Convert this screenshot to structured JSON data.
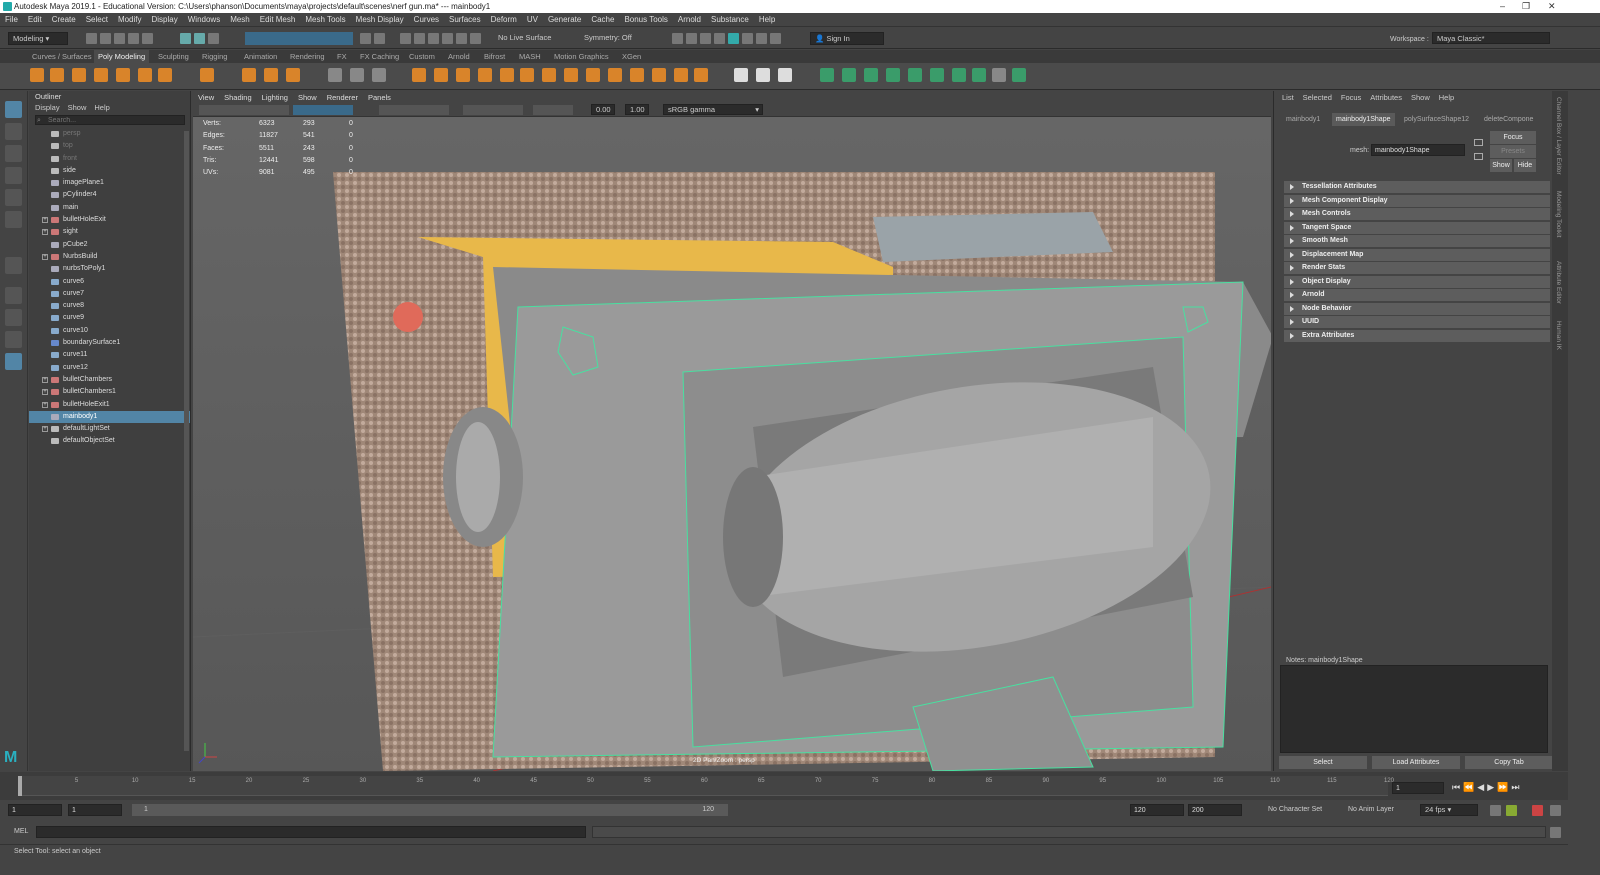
{
  "titlebar": {
    "title": "Autodesk Maya 2019.1 - Educational Version: C:\\Users\\phanson\\Documents\\maya\\projects\\default\\scenes\\nerf gun.ma*  ---  mainbody1"
  },
  "menubar": [
    "File",
    "Edit",
    "Create",
    "Select",
    "Modify",
    "Display",
    "Windows",
    "Mesh",
    "Edit Mesh",
    "Mesh Tools",
    "Mesh Display",
    "Curves",
    "Surfaces",
    "Deform",
    "UV",
    "Generate",
    "Cache",
    "Bonus Tools",
    "Arnold",
    "Substance",
    "Help"
  ],
  "statusline": {
    "mode": "Modeling",
    "live_surface": "No Live Surface",
    "symmetry": "Symmetry: Off",
    "sign_in": "Sign In",
    "workspace_label": "Workspace :",
    "workspace": "Maya Classic*"
  },
  "shelf_tabs": [
    "Curves / Surfaces",
    "Poly Modeling",
    "Sculpting",
    "Rigging",
    "Animation",
    "Rendering",
    "FX",
    "FX Caching",
    "Custom",
    "Arnold",
    "Bifrost",
    "MASH",
    "Motion Graphics",
    "XGen"
  ],
  "shelf_active": "Poly Modeling",
  "outliner": {
    "title": "Outliner",
    "menu": [
      "Display",
      "Show",
      "Help"
    ],
    "search_placeholder": "Search...",
    "items": [
      {
        "name": "persp",
        "dim": true,
        "expand": false,
        "icon": "camera"
      },
      {
        "name": "top",
        "dim": true,
        "expand": false,
        "icon": "camera"
      },
      {
        "name": "front",
        "dim": true,
        "expand": false,
        "icon": "camera"
      },
      {
        "name": "side",
        "dim": false,
        "expand": false,
        "icon": "camera"
      },
      {
        "name": "imagePlane1",
        "dim": false,
        "expand": false,
        "icon": "transform"
      },
      {
        "name": "pCylinder4",
        "dim": false,
        "expand": false,
        "icon": "transform"
      },
      {
        "name": "main",
        "dim": false,
        "expand": false,
        "icon": "transform"
      },
      {
        "name": "bulletHoleExit",
        "dim": false,
        "expand": true,
        "icon": "group"
      },
      {
        "name": "sight",
        "dim": false,
        "expand": true,
        "icon": "group"
      },
      {
        "name": "pCube2",
        "dim": false,
        "expand": false,
        "icon": "transform"
      },
      {
        "name": "NurbsBuild",
        "dim": false,
        "expand": true,
        "icon": "group"
      },
      {
        "name": "nurbsToPoly1",
        "dim": false,
        "expand": false,
        "icon": "transform"
      },
      {
        "name": "curve6",
        "dim": false,
        "expand": false,
        "icon": "curve"
      },
      {
        "name": "curve7",
        "dim": false,
        "expand": false,
        "icon": "curve"
      },
      {
        "name": "curve8",
        "dim": false,
        "expand": false,
        "icon": "curve"
      },
      {
        "name": "curve9",
        "dim": false,
        "expand": false,
        "icon": "curve"
      },
      {
        "name": "curve10",
        "dim": false,
        "expand": false,
        "icon": "curve"
      },
      {
        "name": "boundarySurface1",
        "dim": false,
        "expand": false,
        "icon": "surface"
      },
      {
        "name": "curve11",
        "dim": false,
        "expand": false,
        "icon": "curve"
      },
      {
        "name": "curve12",
        "dim": false,
        "expand": false,
        "icon": "curve"
      },
      {
        "name": "bulletChambers",
        "dim": false,
        "expand": true,
        "icon": "group"
      },
      {
        "name": "bulletChambers1",
        "dim": false,
        "expand": true,
        "icon": "group"
      },
      {
        "name": "bulletHoleExit1",
        "dim": false,
        "expand": true,
        "icon": "group"
      },
      {
        "name": "mainbody1",
        "dim": false,
        "expand": false,
        "icon": "transform",
        "selected": true
      },
      {
        "name": "defaultLightSet",
        "dim": false,
        "expand": true,
        "icon": "set"
      },
      {
        "name": "defaultObjectSet",
        "dim": false,
        "expand": false,
        "icon": "set"
      }
    ]
  },
  "viewport": {
    "menu": [
      "View",
      "Shading",
      "Lighting",
      "Show",
      "Renderer",
      "Panels"
    ],
    "exposure": "0.00",
    "gamma": "1.00",
    "colorspace": "sRGB gamma",
    "camera_label": "2D Pan/Zoom : persp",
    "hud": [
      {
        "label": "Verts:",
        "a": "6323",
        "b": "293",
        "c": "0"
      },
      {
        "label": "Edges:",
        "a": "11827",
        "b": "541",
        "c": "0"
      },
      {
        "label": "Faces:",
        "a": "5511",
        "b": "243",
        "c": "0"
      },
      {
        "label": "Tris:",
        "a": "12441",
        "b": "598",
        "c": "0"
      },
      {
        "label": "UVs:",
        "a": "9081",
        "b": "495",
        "c": "0"
      }
    ]
  },
  "attribute_editor": {
    "menu": [
      "List",
      "Selected",
      "Focus",
      "Attributes",
      "Show",
      "Help"
    ],
    "tabs": [
      "mainbody1",
      "mainbody1Shape",
      "polySurfaceShape12",
      "deleteCompone"
    ],
    "active_tab": "mainbody1Shape",
    "mesh_label": "mesh:",
    "mesh_value": "mainbody1Shape",
    "focus": "Focus",
    "presets": "Presets",
    "show": "Show",
    "hide": "Hide",
    "sections": [
      "Tessellation Attributes",
      "Mesh Component Display",
      "Mesh Controls",
      "Tangent Space",
      "Smooth Mesh",
      "Displacement Map",
      "Render Stats",
      "Object Display",
      "Arnold",
      "Node Behavior",
      "UUID",
      "Extra Attributes"
    ],
    "notes": "Notes:  mainbody1Shape",
    "buttons": [
      "Select",
      "Load Attributes",
      "Copy Tab"
    ]
  },
  "side_tabs": [
    "Channel Box / Layer Editor",
    "Modeling Toolkit",
    "Attribute Editor",
    "Human IK"
  ],
  "timeline": {
    "ticks": [
      "1",
      "5",
      "10",
      "15",
      "20",
      "25",
      "30",
      "35",
      "40",
      "45",
      "50",
      "55",
      "60",
      "65",
      "70",
      "75",
      "80",
      "85",
      "90",
      "95",
      "100",
      "105",
      "110",
      "115",
      "120"
    ],
    "current": "1"
  },
  "range": {
    "start": "1",
    "start2": "1",
    "slider_start": "1",
    "slider_end": "120",
    "end": "120",
    "end2": "200",
    "character_set": "No Character Set",
    "anim_layer": "No Anim Layer",
    "fps": "24 fps"
  },
  "cmdline": {
    "label": "MEL"
  },
  "helpline": {
    "text": "Select Tool: select an object"
  }
}
